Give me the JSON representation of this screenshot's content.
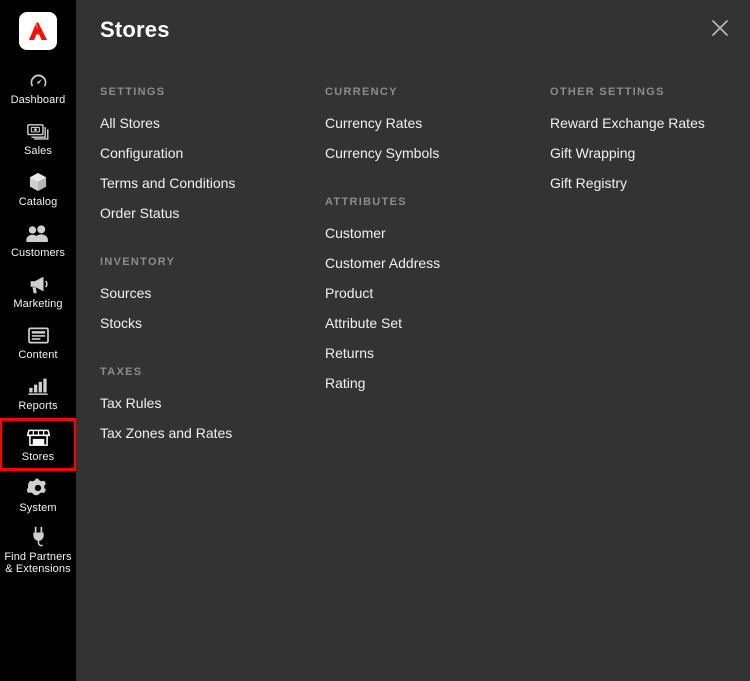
{
  "sidebar": {
    "logo": {
      "name": "adobe-commerce-logo",
      "color": "#fa0f00",
      "background": "#ffffff"
    },
    "highlight_color": "#ff0000",
    "active_item": "Stores",
    "items": [
      {
        "label": "Dashboard",
        "icon": "dashboard-gauge-icon"
      },
      {
        "label": "Sales",
        "icon": "sales-money-icon"
      },
      {
        "label": "Catalog",
        "icon": "catalog-box-icon"
      },
      {
        "label": "Customers",
        "icon": "customers-people-icon"
      },
      {
        "label": "Marketing",
        "icon": "marketing-megaphone-icon"
      },
      {
        "label": "Content",
        "icon": "content-page-icon"
      },
      {
        "label": "Reports",
        "icon": "reports-bar-chart-icon"
      },
      {
        "label": "Stores",
        "icon": "stores-shop-icon"
      },
      {
        "label": "System",
        "icon": "system-gear-icon"
      },
      {
        "label": "Find Partners\n& Extensions",
        "icon": "partners-plug-icon"
      }
    ]
  },
  "header": {
    "title": "Stores",
    "close_label": "close-icon"
  },
  "menu": {
    "columns": [
      {
        "groups": [
          {
            "title": "SETTINGS",
            "links": [
              "All Stores",
              "Configuration",
              "Terms and Conditions",
              "Order Status"
            ]
          },
          {
            "title": "INVENTORY",
            "links": [
              "Sources",
              "Stocks"
            ]
          },
          {
            "title": "TAXES",
            "links": [
              "Tax Rules",
              "Tax Zones and Rates"
            ]
          }
        ]
      },
      {
        "groups": [
          {
            "title": "CURRENCY",
            "links": [
              "Currency Rates",
              "Currency Symbols"
            ]
          },
          {
            "title": "ATTRIBUTES",
            "links": [
              "Customer",
              "Customer Address",
              "Product",
              "Attribute Set",
              "Returns",
              "Rating"
            ]
          }
        ]
      },
      {
        "groups": [
          {
            "title": "OTHER SETTINGS",
            "links": [
              "Reward Exchange Rates",
              "Gift Wrapping",
              "Gift Registry"
            ]
          }
        ]
      }
    ]
  },
  "colors": {
    "sidebar_bg": "#000000",
    "panel_bg": "#333333",
    "text": "#f0f0f0",
    "group_title": "#8c8c8c",
    "accent_red": "#ff0000"
  }
}
